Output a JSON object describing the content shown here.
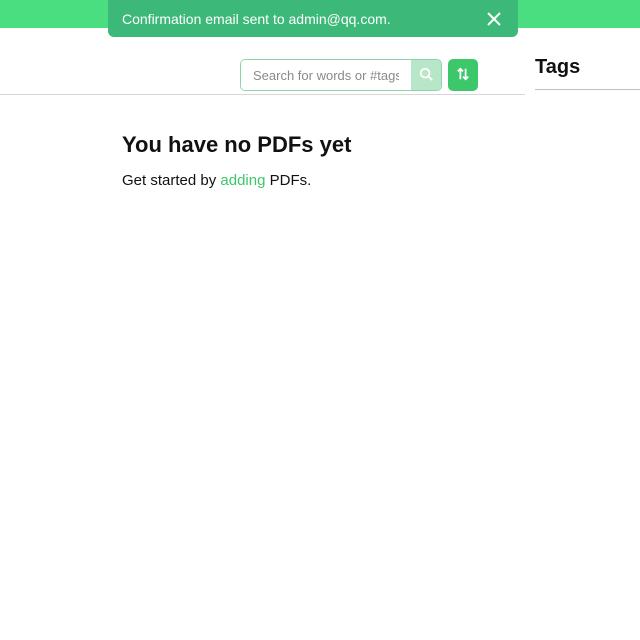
{
  "toast": {
    "message": "Confirmation email sent to admin@qq.com."
  },
  "search": {
    "placeholder": "Search for words or #tags"
  },
  "tags": {
    "heading": "Tags"
  },
  "empty": {
    "title": "You have no PDFs yet",
    "sub_prefix": "Get started by ",
    "link": "adding",
    "sub_suffix": " PDFs."
  }
}
